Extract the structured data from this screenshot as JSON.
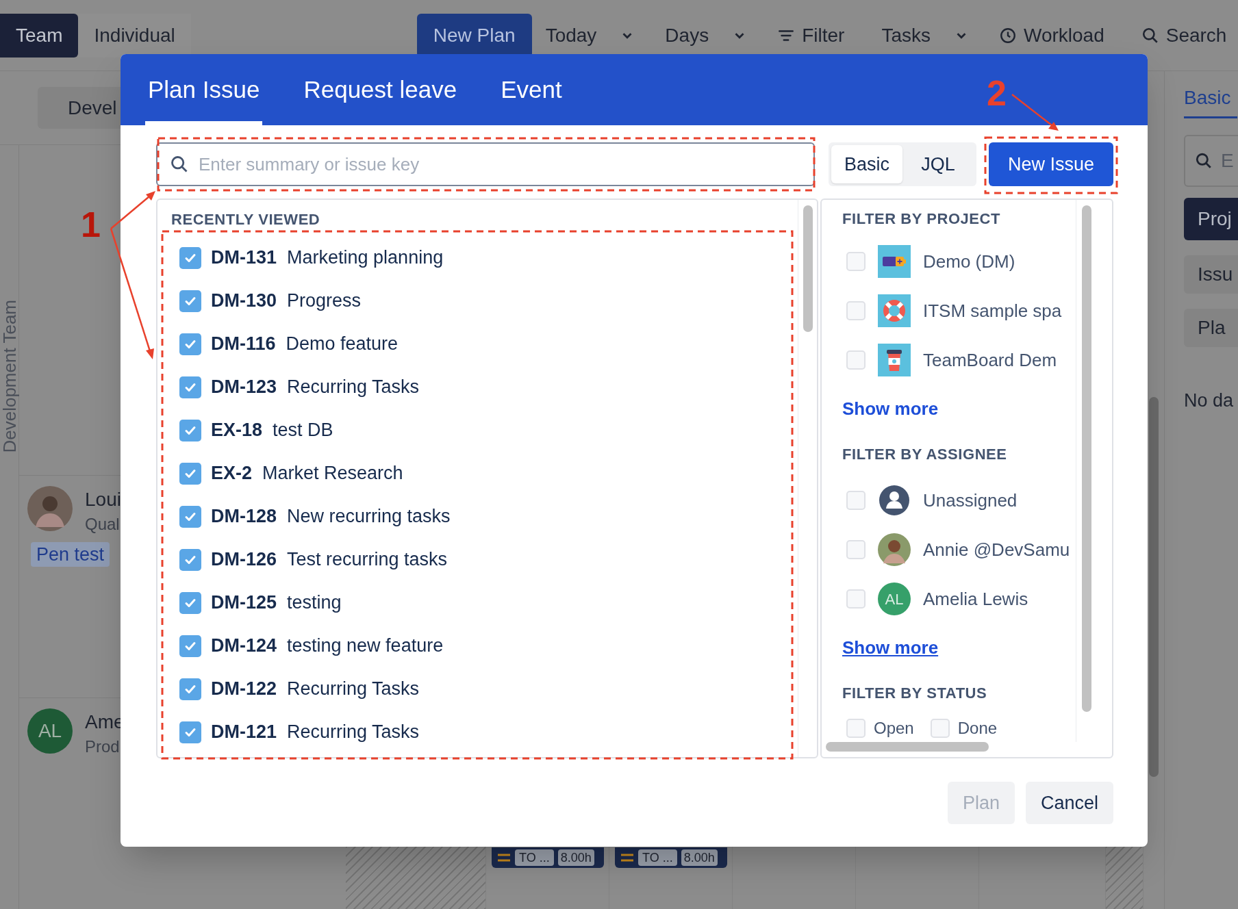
{
  "top_bar": {
    "view_tabs": [
      {
        "label": "Team",
        "selected": true
      },
      {
        "label": "Individual",
        "selected": false
      }
    ],
    "new_plan_button": "New Plan",
    "controls": [
      {
        "label": "Today",
        "kind": "dropdown"
      },
      {
        "label": "Days",
        "kind": "dropdown"
      },
      {
        "label": "Filter",
        "kind": "filter"
      },
      {
        "label": "Tasks",
        "kind": "dropdown"
      },
      {
        "label": "Workload",
        "kind": "clock"
      },
      {
        "label": "Search",
        "kind": "search"
      }
    ]
  },
  "background": {
    "group_button": "Devel",
    "team_label": "Development Team",
    "members": [
      {
        "kind": "photo",
        "name": "Loui",
        "role": "Qual",
        "tag": "Pen test"
      },
      {
        "kind": "initials",
        "initials": "AL",
        "name": "Ame",
        "role": "Prod"
      }
    ],
    "bars": [
      {
        "status": "TO ...",
        "hours": "8.00h"
      },
      {
        "status": "TO ...",
        "hours": "8.00h"
      }
    ],
    "side_panel": {
      "tab": "Basic",
      "search_placeholder": "E",
      "buttons": [
        {
          "label": "Proj",
          "selected": true
        },
        {
          "label": "Issu",
          "selected": false
        },
        {
          "label": "Pla",
          "selected": false
        }
      ],
      "empty_text": "No da"
    }
  },
  "dialog": {
    "tabs": [
      {
        "label": "Plan Issue",
        "selected": true
      },
      {
        "label": "Request leave",
        "selected": false
      },
      {
        "label": "Event",
        "selected": false
      }
    ],
    "search_placeholder": "Enter summary or issue key",
    "mode_toggle": [
      {
        "label": "Basic",
        "selected": true
      },
      {
        "label": "JQL",
        "selected": false
      }
    ],
    "new_issue_button": "New Issue",
    "recently_viewed": {
      "heading": "RECENTLY VIEWED",
      "items": [
        {
          "key": "DM-131",
          "summary": "Marketing planning",
          "checked": true
        },
        {
          "key": "DM-130",
          "summary": "Progress",
          "checked": true
        },
        {
          "key": "DM-116",
          "summary": "Demo feature",
          "checked": true
        },
        {
          "key": "DM-123",
          "summary": "Recurring Tasks",
          "checked": true
        },
        {
          "key": "EX-18",
          "summary": "test DB",
          "checked": true
        },
        {
          "key": "EX-2",
          "summary": "Market Research",
          "checked": true
        },
        {
          "key": "DM-128",
          "summary": "New recurring tasks",
          "checked": true
        },
        {
          "key": "DM-126",
          "summary": "Test recurring tasks",
          "checked": true
        },
        {
          "key": "DM-125",
          "summary": "testing",
          "checked": true
        },
        {
          "key": "DM-124",
          "summary": "testing new feature",
          "checked": true
        },
        {
          "key": "DM-122",
          "summary": "Recurring Tasks",
          "checked": true
        },
        {
          "key": "DM-121",
          "summary": "Recurring Tasks",
          "checked": true
        }
      ]
    },
    "filters": [
      {
        "heading": "FILTER BY PROJECT",
        "kind": "list",
        "items": [
          {
            "label": "Demo (DM)",
            "kind": "battery",
            "checked": false
          },
          {
            "label": "ITSM sample spa",
            "kind": "lifebuoy",
            "checked": false
          },
          {
            "label": "TeamBoard Dem",
            "kind": "cup",
            "checked": false
          }
        ],
        "show_more": {
          "label": "Show more",
          "hovered": false
        }
      },
      {
        "heading": "FILTER BY ASSIGNEE",
        "kind": "list",
        "items": [
          {
            "label": "Unassigned",
            "kind": "person",
            "checked": false
          },
          {
            "label": "Annie @DevSamu",
            "kind": "photo",
            "checked": false
          },
          {
            "label": "Amelia Lewis",
            "kind": "initials",
            "initials": "AL",
            "checked": false
          }
        ],
        "show_more": {
          "label": "Show more",
          "hovered": true
        }
      },
      {
        "heading": "FILTER BY STATUS",
        "kind": "inline",
        "items": [
          {
            "label": "Open",
            "checked": false
          },
          {
            "label": "Done",
            "checked": false
          }
        ]
      }
    ],
    "footer_buttons": [
      {
        "label": "Plan",
        "disabled": true
      },
      {
        "label": "Cancel",
        "disabled": false
      }
    ]
  },
  "annotations": [
    {
      "label": "1"
    },
    {
      "label": "2"
    }
  ]
}
